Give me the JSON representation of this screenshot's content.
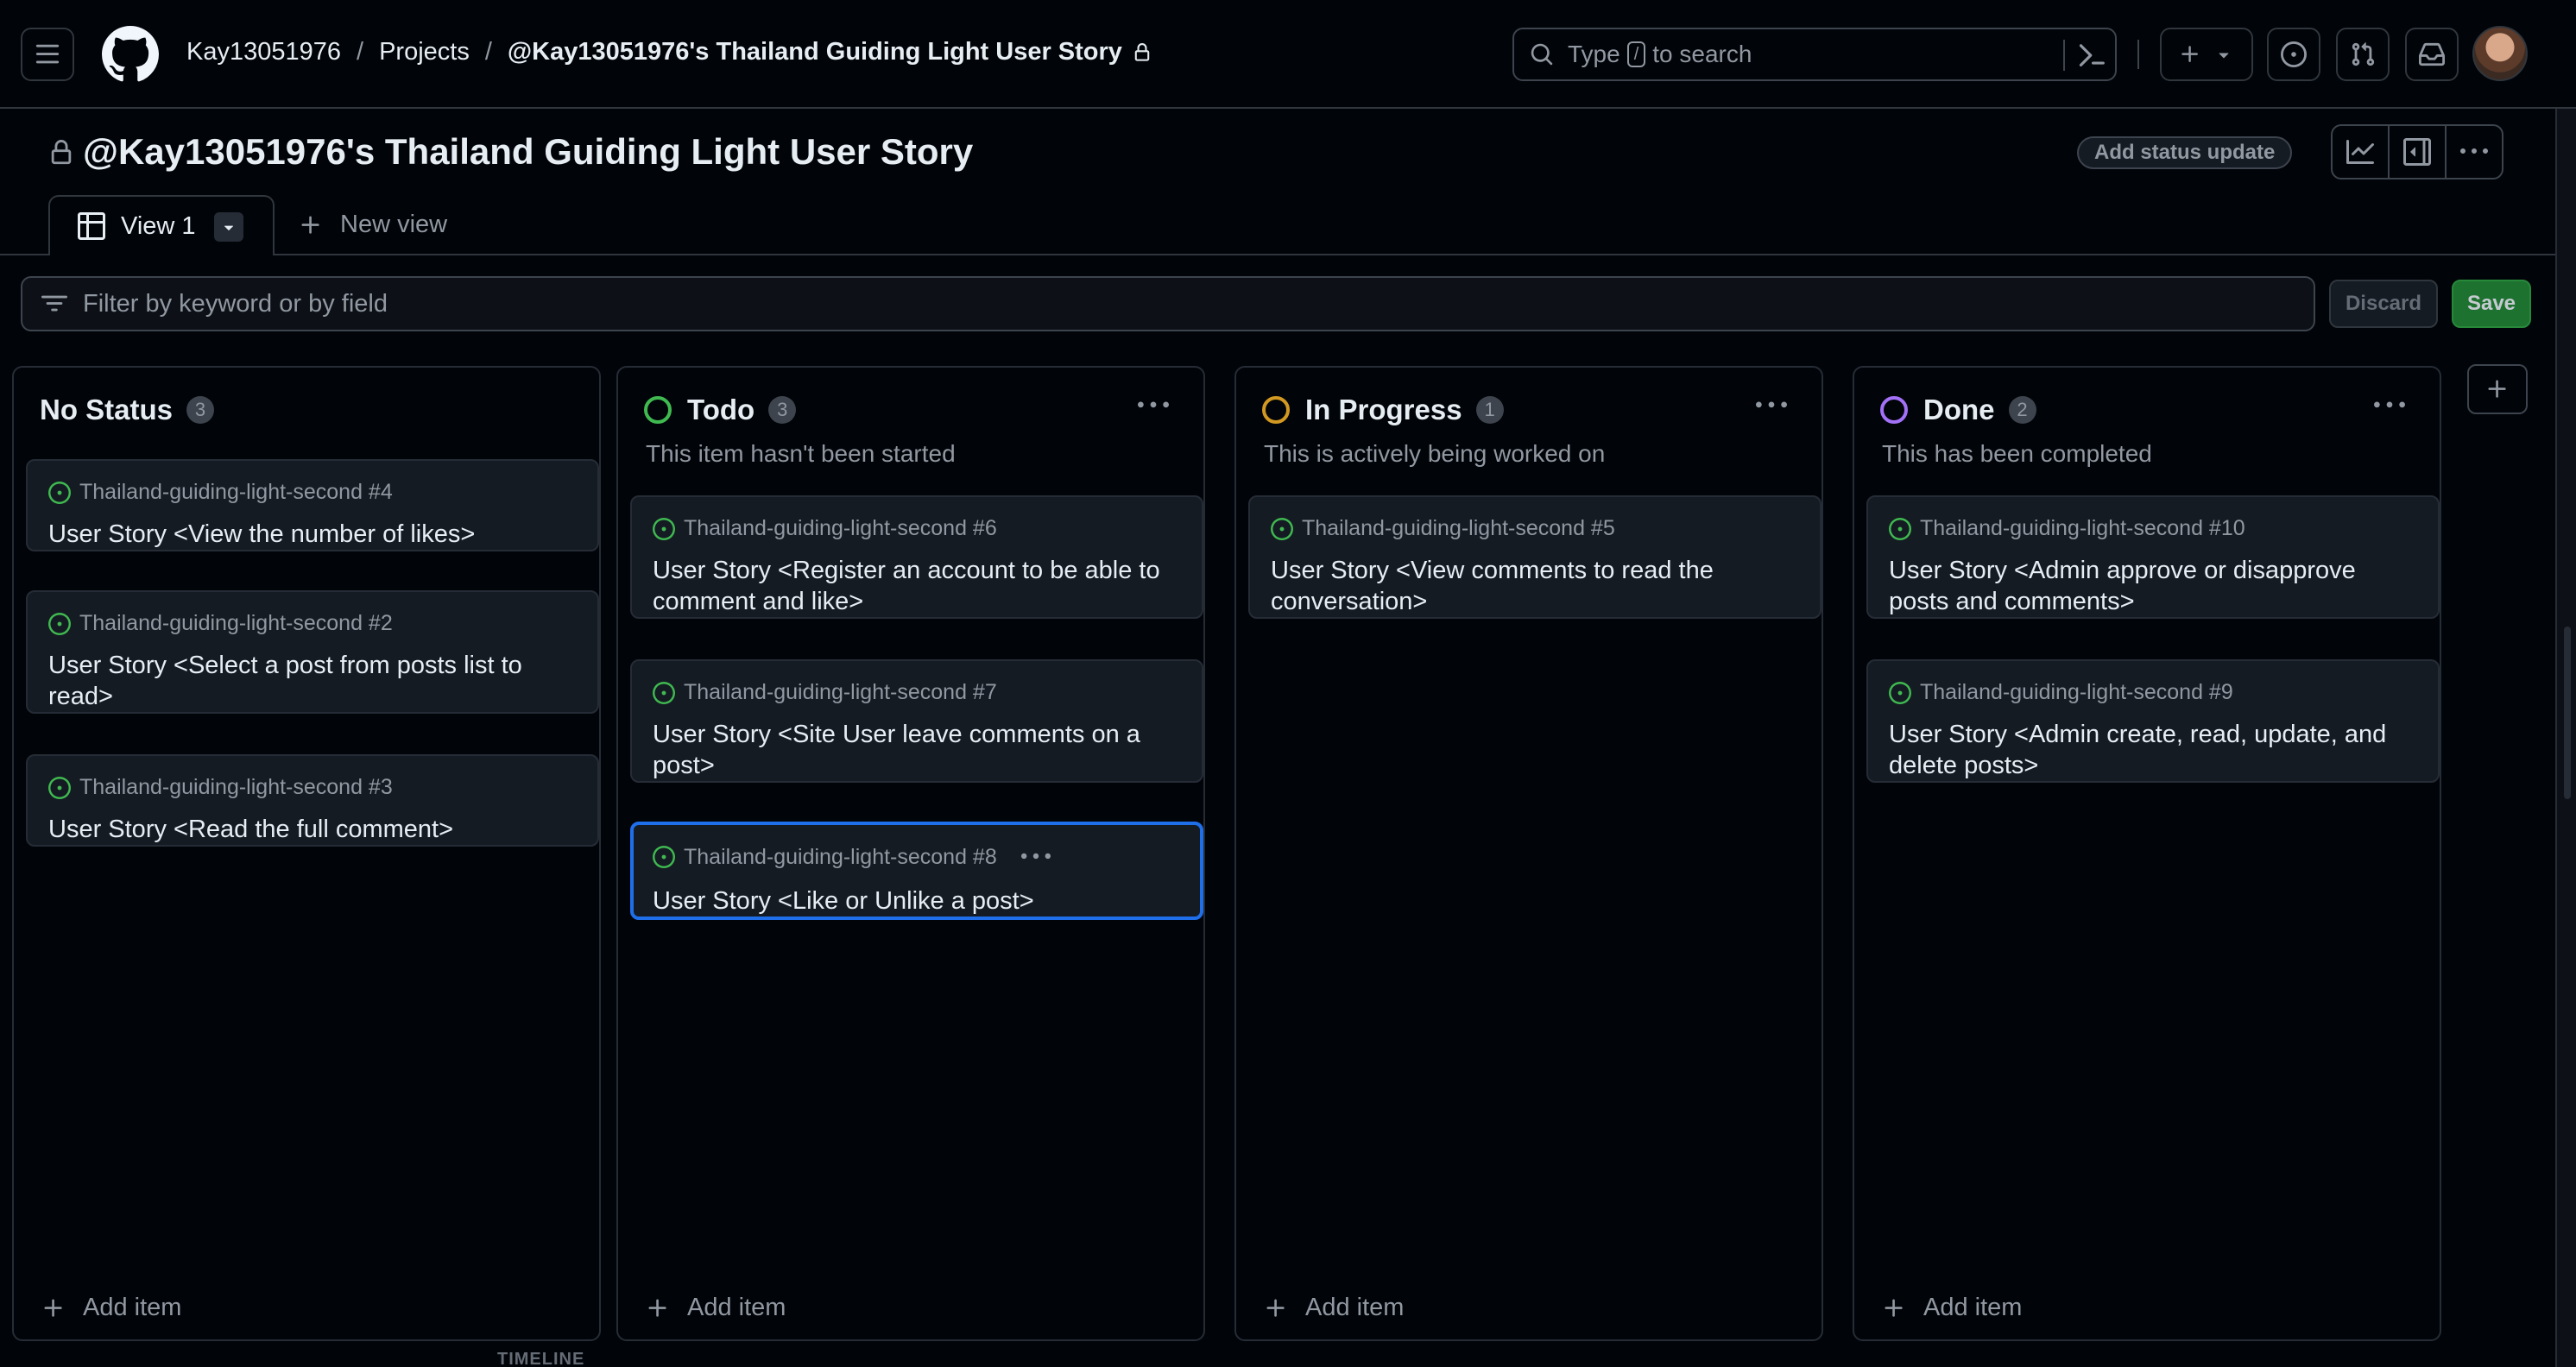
{
  "header": {
    "breadcrumbs": [
      "Kay13051976",
      "Projects",
      "@Kay13051976's Thailand Guiding Light User Story"
    ],
    "search": {
      "prefix": "Type",
      "key": "/",
      "suffix": "to search"
    }
  },
  "project": {
    "title": "@Kay13051976's Thailand Guiding Light User Story",
    "status_update_label": "Add status update"
  },
  "tabs": {
    "active_label": "View 1",
    "new_view_label": "New view"
  },
  "filter": {
    "placeholder": "Filter by keyword or by field",
    "discard_label": "Discard",
    "save_label": "Save"
  },
  "colors": {
    "todo": "#3fb950",
    "in_progress": "#d29922",
    "done": "#a371f7",
    "accent_selected": "#1f6feb",
    "save_green": "#238636"
  },
  "columns": [
    {
      "name": "No Status",
      "count": "3",
      "description": "",
      "add_item": "Add item",
      "cards": [
        {
          "repo": "Thailand-guiding-light-second #4",
          "title": "User Story <View the number of likes>"
        },
        {
          "repo": "Thailand-guiding-light-second #2",
          "title": "User Story <Select a post from posts list to read>"
        },
        {
          "repo": "Thailand-guiding-light-second #3",
          "title": "User Story <Read the full comment>"
        }
      ]
    },
    {
      "name": "Todo",
      "count": "3",
      "description": "This item hasn't been started",
      "add_item": "Add item",
      "cards": [
        {
          "repo": "Thailand-guiding-light-second #6",
          "title": "User Story <Register an account to be able to comment and like>"
        },
        {
          "repo": "Thailand-guiding-light-second #7",
          "title": "User Story <Site User leave comments on a post>"
        },
        {
          "repo": "Thailand-guiding-light-second #8",
          "title": "User Story <Like or Unlike a post>"
        }
      ]
    },
    {
      "name": "In Progress",
      "count": "1",
      "description": "This is actively being worked on",
      "add_item": "Add item",
      "cards": [
        {
          "repo": "Thailand-guiding-light-second #5",
          "title": "User Story <View comments to read the conversation>"
        }
      ]
    },
    {
      "name": "Done",
      "count": "2",
      "description": "This has been completed",
      "add_item": "Add item",
      "cards": [
        {
          "repo": "Thailand-guiding-light-second #10",
          "title": "User Story <Admin approve or disapprove posts and comments>"
        },
        {
          "repo": "Thailand-guiding-light-second #9",
          "title": "User Story <Admin create, read, update, and delete posts>"
        }
      ]
    }
  ],
  "footer": {
    "label": "TIMELINE"
  }
}
